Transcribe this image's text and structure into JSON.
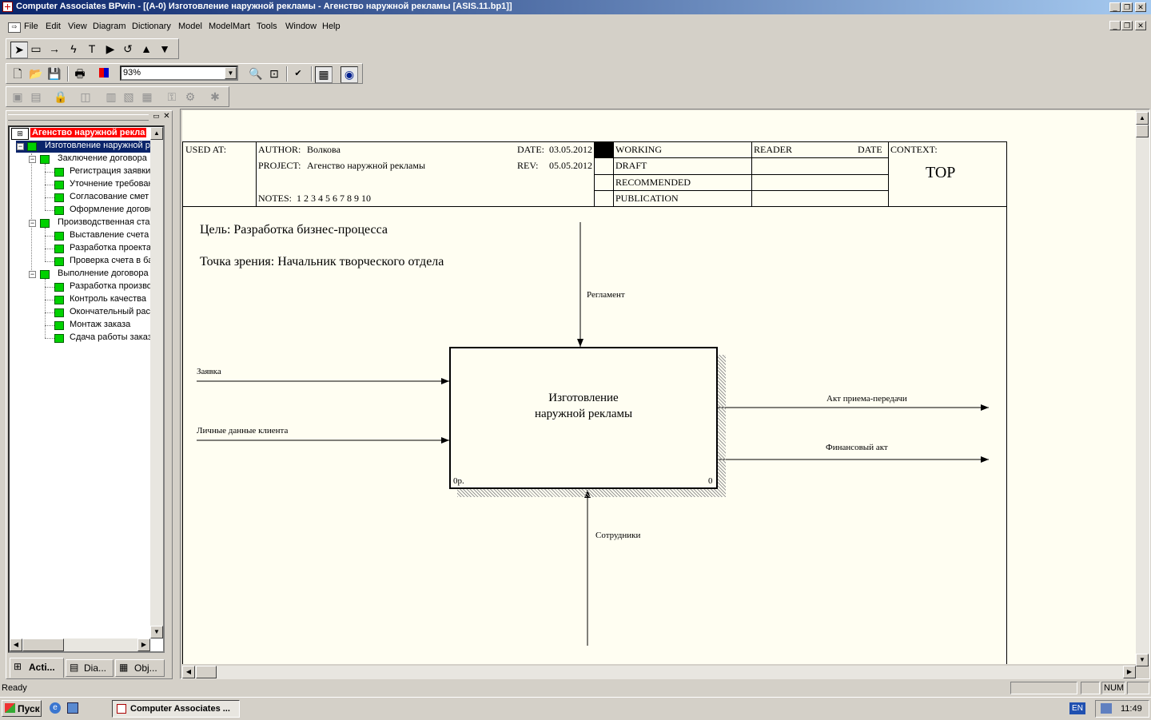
{
  "window": {
    "title": "Computer Associates BPwin - [(A-0) Изготовление  наружной рекламы - Агенство наружной рекламы  [ASIS.11.bp1]]"
  },
  "menu": [
    "File",
    "Edit",
    "View",
    "Diagram",
    "Dictionary",
    "Model",
    "ModelMart",
    "Tools",
    "Window",
    "Help"
  ],
  "toolbar": {
    "zoom": "93%"
  },
  "tree": {
    "root": "Агенство наружной рекла",
    "top_activity": "Изготовление  наружной р",
    "groups": [
      {
        "label": "Заключение договора",
        "children": [
          "Регистрация  заявки",
          "Уточнение  требован",
          "Согласование  смет",
          "Оформление  догово"
        ]
      },
      {
        "label": "Производственная  ста",
        "children": [
          "Выставление  счета",
          "Разработка  проекта",
          "Проверка  счета в ба"
        ]
      },
      {
        "label": "Выполнение  договора",
        "children": [
          "Разработка  произво",
          "Контроль качества",
          "Окончательный  рас",
          "Монтаж  заказа",
          "Сдача работы  заказ"
        ]
      }
    ],
    "tabs": [
      "Acti...",
      "Dia...",
      "Obj..."
    ]
  },
  "diagram": {
    "header": {
      "used_at": "USED AT:",
      "author_label": "AUTHOR:",
      "author": "Волкова",
      "project_label": "PROJECT:",
      "project": "Агенство наружной рекламы",
      "date_label": "DATE:",
      "date": "03.05.2012",
      "rev_label": "REV:",
      "rev": "05.05.2012",
      "notes_label": "NOTES:",
      "notes": "1  2  3  4  5  6  7  8  9  10",
      "status": [
        "WORKING",
        "DRAFT",
        "RECOMMENDED",
        "PUBLICATION"
      ],
      "reader": "READER",
      "reader_date": "DATE",
      "context": "CONTEXT:",
      "context_value": "TOP"
    },
    "purpose": "Цель: Разработка бизнес-процесса",
    "viewpoint": "Точка зрения: Начальник творческого отдела",
    "box": {
      "title": "Изготовление наружной рекламы",
      "cost": "0р.",
      "number": "0"
    },
    "arrows": {
      "control": "Регламент",
      "input1": "Заявка",
      "input2": "Личные данные клиента",
      "output1": "Акт приема-передачи",
      "output2": "Финансовый акт",
      "mechanism": "Сотрудники"
    }
  },
  "status": {
    "text": "Ready",
    "num": "NUM"
  },
  "taskbar": {
    "start": "Пуск",
    "task": "Computer Associates ...",
    "lang": "EN",
    "clock": "11:49"
  }
}
